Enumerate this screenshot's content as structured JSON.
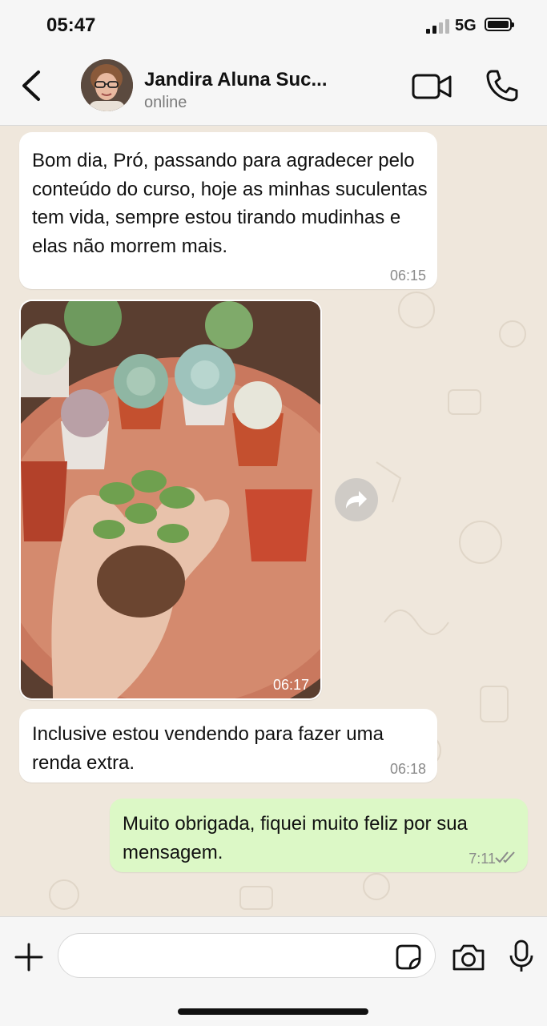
{
  "status_bar": {
    "time": "05:47",
    "network": "5G"
  },
  "header": {
    "contact_name": "Jandira Aluna Suc...",
    "contact_status": "online"
  },
  "messages": [
    {
      "direction": "incoming",
      "type": "text",
      "text": "Bom dia, Pró, passando para agradecer pelo conteúdo do curso, hoje as minhas suculentas tem vida, sempre estou tirando mudinhas e elas não morrem mais.",
      "time": "06:15"
    },
    {
      "direction": "incoming",
      "type": "image",
      "time": "06:17"
    },
    {
      "direction": "incoming",
      "type": "text",
      "text": "Inclusive estou vendendo para fazer uma renda extra.",
      "time": "06:18"
    },
    {
      "direction": "outgoing",
      "type": "text",
      "text": "Muito obrigada, fiquei muito feliz por sua mensagem.",
      "time": "7:11",
      "read": true
    }
  ],
  "input": {
    "placeholder": ""
  },
  "icons": {
    "back": "chevron-left-icon",
    "video": "video-camera-icon",
    "call": "phone-icon",
    "forward": "forward-arrow-icon",
    "plus": "plus-icon",
    "sticker": "sticker-icon",
    "camera": "camera-icon",
    "mic": "microphone-icon",
    "read": "double-check-icon"
  },
  "colors": {
    "chat_background": "#efe7dc",
    "incoming_bubble": "#ffffff",
    "outgoing_bubble": "#dcf8c6",
    "read_ticks": "#8a8a8a"
  }
}
